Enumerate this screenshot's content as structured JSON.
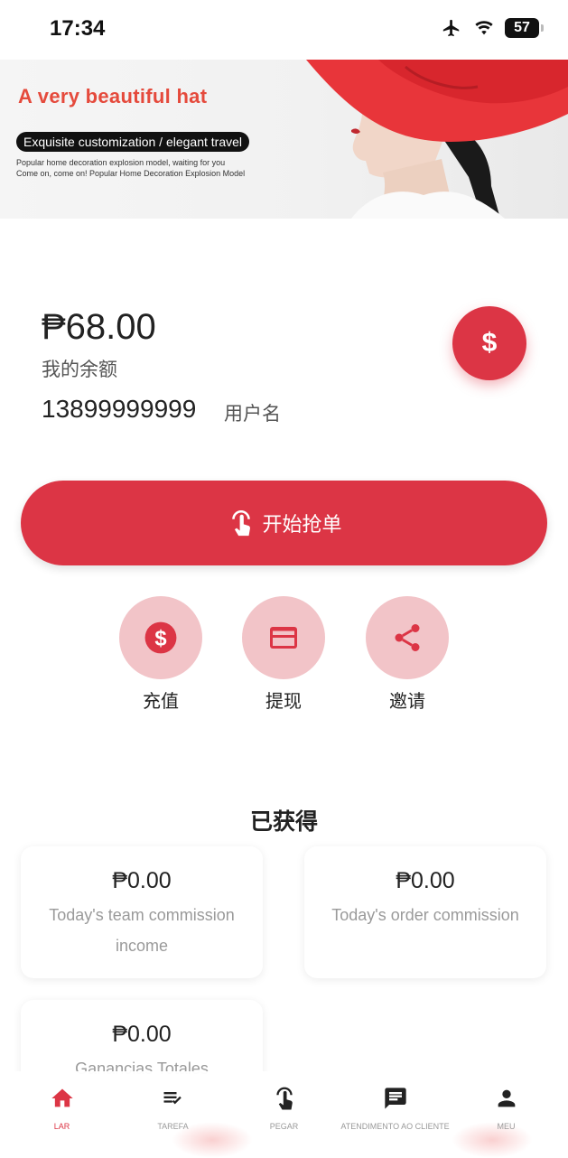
{
  "status_bar": {
    "time": "17:34",
    "battery": "57"
  },
  "banner": {
    "title": "A very beautiful hat",
    "pill_text": "Exquisite customization / elegant travel",
    "small_line1": "Popular home decoration explosion model, waiting for you",
    "small_line2": "Come on, come on! Popular Home Decoration Explosion Model"
  },
  "account": {
    "balance": "₱68.00",
    "balance_label": "我的余额",
    "account_number": "13899999999",
    "username_label": "用户名",
    "balance_button_icon": "dollar-icon"
  },
  "start_button": {
    "label": "开始抢单",
    "icon": "tap-hand-icon"
  },
  "actions": [
    {
      "label": "充值",
      "icon": "dollar-circle-icon"
    },
    {
      "label": "提现",
      "icon": "credit-card-icon"
    },
    {
      "label": "邀请",
      "icon": "share-icon"
    }
  ],
  "earnings": {
    "title": "已获得",
    "cards": [
      {
        "value": "₱0.00",
        "label": "Today's team commission income"
      },
      {
        "value": "₱0.00",
        "label": "Today's order commission"
      },
      {
        "value": "₱0.00",
        "label": "Ganancias Totales"
      }
    ]
  },
  "bottom_nav": [
    {
      "label": "LAR",
      "icon": "home-icon",
      "active": true
    },
    {
      "label": "TAREFA",
      "icon": "task-list-icon",
      "active": false
    },
    {
      "label": "PEGAR",
      "icon": "tap-hand-icon",
      "active": false
    },
    {
      "label": "ATENDIMENTO AO CLIENTE",
      "icon": "chat-icon",
      "active": false
    },
    {
      "label": "MEU",
      "icon": "person-icon",
      "active": false
    }
  ],
  "colors": {
    "accent": "#dc3545",
    "accent_light": "#f2c4c8",
    "banner_title": "#e54a3c"
  }
}
